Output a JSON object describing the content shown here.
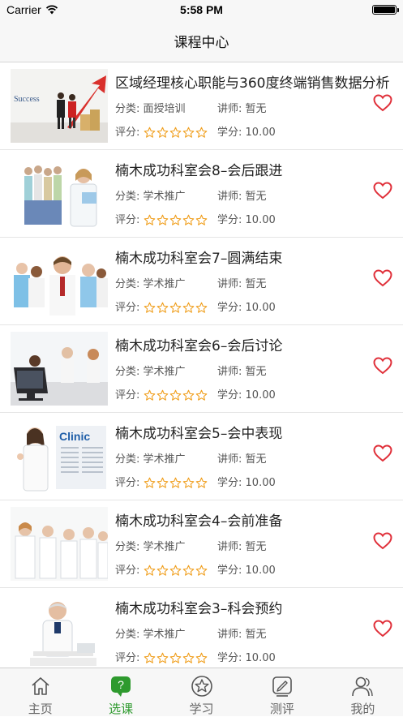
{
  "status_bar": {
    "carrier": "Carrier",
    "time": "5:58 PM"
  },
  "nav": {
    "title": "课程中心"
  },
  "courses": [
    {
      "title": "区域经理核心职能与360度终端销售数据分析",
      "category_label": "分类:",
      "category": "面授培训",
      "lecturer_label": "讲师:",
      "lecturer": "暂无",
      "rating_label": "评分:",
      "credit_label": "学分:",
      "credit": "10.00",
      "thumb_text": "Success"
    },
    {
      "title": "楠木成功科室会8–会后跟进",
      "category_label": "分类:",
      "category": "学术推广",
      "lecturer_label": "讲师:",
      "lecturer": "暂无",
      "rating_label": "评分:",
      "credit_label": "学分:",
      "credit": "10.00"
    },
    {
      "title": "楠木成功科室会7–圆满结束",
      "category_label": "分类:",
      "category": "学术推广",
      "lecturer_label": "讲师:",
      "lecturer": "暂无",
      "rating_label": "评分:",
      "credit_label": "学分:",
      "credit": "10.00"
    },
    {
      "title": "楠木成功科室会6–会后讨论",
      "category_label": "分类:",
      "category": "学术推广",
      "lecturer_label": "讲师:",
      "lecturer": "暂无",
      "rating_label": "评分:",
      "credit_label": "学分:",
      "credit": "10.00"
    },
    {
      "title": "楠木成功科室会5–会中表现",
      "category_label": "分类:",
      "category": "学术推广",
      "lecturer_label": "讲师:",
      "lecturer": "暂无",
      "rating_label": "评分:",
      "credit_label": "学分:",
      "credit": "10.00",
      "thumb_text": "Clinic"
    },
    {
      "title": "楠木成功科室会4–会前准备",
      "category_label": "分类:",
      "category": "学术推广",
      "lecturer_label": "讲师:",
      "lecturer": "暂无",
      "rating_label": "评分:",
      "credit_label": "学分:",
      "credit": "10.00"
    },
    {
      "title": "楠木成功科室会3–科会预约",
      "category_label": "分类:",
      "category": "学术推广",
      "lecturer_label": "讲师:",
      "lecturer": "暂无",
      "rating_label": "评分:",
      "credit_label": "学分:",
      "credit": "10.00"
    }
  ],
  "rating_stars_total": 5,
  "rating_stars_filled": 0,
  "tabs": [
    {
      "label": "主页",
      "icon": "home-icon",
      "active": false
    },
    {
      "label": "选课",
      "icon": "question-bubble-icon",
      "active": true
    },
    {
      "label": "学习",
      "icon": "star-badge-icon",
      "active": false
    },
    {
      "label": "测评",
      "icon": "edit-icon",
      "active": false
    },
    {
      "label": "我的",
      "icon": "user-icon",
      "active": false
    }
  ],
  "colors": {
    "accent_green": "#2e9a2e",
    "heart_red": "#e0303a",
    "star_outline": "#f0a020"
  }
}
